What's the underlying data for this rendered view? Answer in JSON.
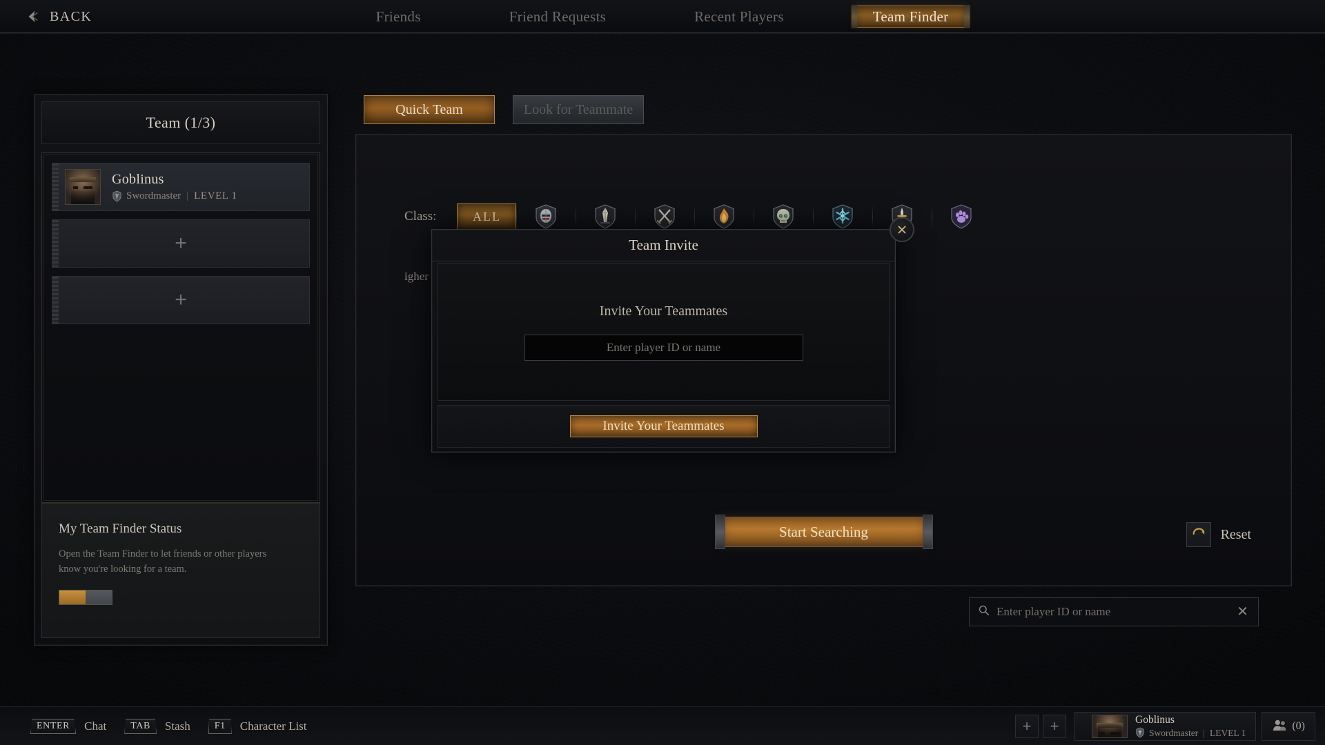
{
  "topbar": {
    "back_label": "BACK",
    "tabs": [
      {
        "label": "Friends",
        "active": false
      },
      {
        "label": "Friend Requests",
        "active": false
      },
      {
        "label": "Recent Players",
        "active": false
      },
      {
        "label": "Team Finder",
        "active": true
      }
    ]
  },
  "team_panel": {
    "title": "Team (1/3)",
    "members": [
      {
        "name": "Goblinus",
        "class": "Swordmaster",
        "level_label": "LEVEL 1",
        "divider": "|"
      }
    ],
    "empty_slot_glyph": "+",
    "empty_slots": 2
  },
  "team_finder_status": {
    "title": "My Team Finder Status",
    "description": "Open the Team Finder to let friends or other players know you're looking for a team.",
    "toggle_state": "on"
  },
  "main": {
    "mode_tabs": [
      {
        "label": "Quick Team",
        "active": true
      },
      {
        "label": "Look for Teammate",
        "active": false
      }
    ],
    "class_filter": {
      "label": "Class:",
      "all_label": "ALL",
      "options": [
        {
          "name": "ALL",
          "icon": "all-classes-icon",
          "selected": true
        },
        {
          "name": "Knight",
          "icon": "knight-helm-icon",
          "selected": false
        },
        {
          "name": "Banner",
          "icon": "banner-icon",
          "selected": false
        },
        {
          "name": "Warrior",
          "icon": "crossed-swords-icon",
          "selected": false
        },
        {
          "name": "Pyromancer",
          "icon": "flame-icon",
          "selected": false
        },
        {
          "name": "Necromancer",
          "icon": "skull-icon",
          "selected": false
        },
        {
          "name": "Cryomancer",
          "icon": "snowflake-icon",
          "selected": false
        },
        {
          "name": "Swordmaster",
          "icon": "sword-icon",
          "selected": false
        },
        {
          "name": "Druid",
          "icon": "paw-icon",
          "selected": false
        }
      ]
    },
    "level_note_partial": "igher",
    "start_button": "Start Searching",
    "reset_button": "Reset",
    "search": {
      "placeholder": "Enter player ID or name",
      "value": "",
      "clear_glyph": "✕"
    }
  },
  "modal": {
    "title": "Team Invite",
    "body_label": "Invite Your Teammates",
    "input_placeholder": "Enter player ID or name",
    "input_value": "",
    "cta_label": "Invite Your Teammates",
    "close_glyph": "X"
  },
  "bottombar": {
    "hotkeys": [
      {
        "key": "ENTER",
        "label": "Chat"
      },
      {
        "key": "TAB",
        "label": "Stash"
      },
      {
        "key": "F1",
        "label": "Character List"
      }
    ],
    "add_glyph": "+",
    "player": {
      "name": "Goblinus",
      "class": "Swordmaster",
      "divider": "|",
      "level_label": "LEVEL 1"
    },
    "friends_count": "(0)"
  },
  "colors": {
    "accent_gold": "#b8792e",
    "accent_border": "#b3853d",
    "text_primary": "#ded6c6",
    "text_muted": "#7e7a72",
    "panel_bg": "#111216"
  }
}
